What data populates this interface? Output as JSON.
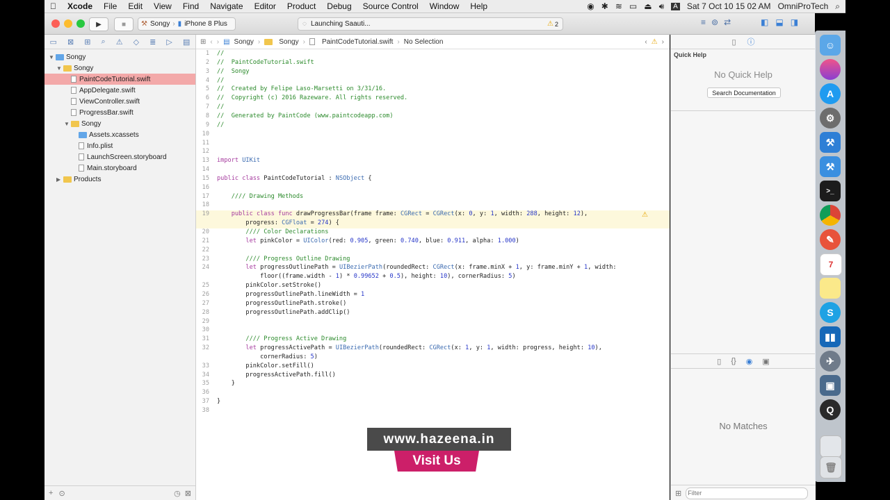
{
  "menubar": {
    "apple": "",
    "items": [
      "Xcode",
      "File",
      "Edit",
      "View",
      "Find",
      "Navigate",
      "Editor",
      "Product",
      "Debug",
      "Source Control",
      "Window",
      "Help"
    ],
    "clock": "Sat 7 Oct 10 15 02 AM",
    "user": "OmniProTech",
    "input_menu": "A"
  },
  "toolbar": {
    "scheme_project": "Songy",
    "scheme_device": "iPhone 8 Plus",
    "activity": "Launching Saauti...",
    "warning_count": "2"
  },
  "navigator": {
    "rows": [
      {
        "label": "Songy",
        "kind": "project",
        "indent": 0,
        "disclosure": "▼"
      },
      {
        "label": "Songy",
        "kind": "folder",
        "indent": 1,
        "disclosure": "▼"
      },
      {
        "label": "PaintCodeTutorial.swift",
        "kind": "file",
        "indent": 2,
        "selected": true
      },
      {
        "label": "AppDelegate.swift",
        "kind": "file",
        "indent": 2
      },
      {
        "label": "ViewController.swift",
        "kind": "file",
        "indent": 2
      },
      {
        "label": "ProgressBar.swift",
        "kind": "file",
        "indent": 2
      },
      {
        "label": "Songy",
        "kind": "folder",
        "indent": 2,
        "disclosure": "▼"
      },
      {
        "label": "Assets.xcassets",
        "kind": "asset",
        "indent": 3
      },
      {
        "label": "Info.plist",
        "kind": "file",
        "indent": 3
      },
      {
        "label": "LaunchScreen.storyboard",
        "kind": "file",
        "indent": 3
      },
      {
        "label": "Main.storyboard",
        "kind": "file",
        "indent": 3
      },
      {
        "label": "Products",
        "kind": "folder",
        "indent": 1,
        "disclosure": "▶"
      }
    ]
  },
  "jumpbar": {
    "crumbs": [
      "Songy",
      "Songy",
      "PaintCodeTutorial.swift",
      "No Selection"
    ]
  },
  "code": {
    "lines": [
      {
        "n": "1",
        "t": "//",
        "c": "cm"
      },
      {
        "n": "2",
        "t": "//  PaintCodeTutorial.swift",
        "c": "cm"
      },
      {
        "n": "3",
        "t": "//  Songy",
        "c": "cm"
      },
      {
        "n": "4",
        "t": "//",
        "c": "cm"
      },
      {
        "n": "5",
        "t": "//  Created by Felipe Laso-Marsetti on 3/31/16.",
        "c": "cm"
      },
      {
        "n": "6",
        "t": "//  Copyright (c) 2016 Razeware. All rights reserved.",
        "c": "cm"
      },
      {
        "n": "7",
        "t": "//",
        "c": "cm"
      },
      {
        "n": "8",
        "t": "//  Generated by PaintCode (www.paintcodeapp.com)",
        "c": "cm"
      },
      {
        "n": "9",
        "t": "//",
        "c": "cm"
      },
      {
        "n": "10",
        "t": "",
        "c": ""
      },
      {
        "n": "11",
        "t": "",
        "c": ""
      },
      {
        "n": "12",
        "t": "",
        "c": ""
      },
      {
        "n": "13",
        "t": "import UIKit",
        "c": ""
      },
      {
        "n": "14",
        "t": "",
        "c": ""
      },
      {
        "n": "15",
        "t": "public class PaintCodeTutorial : NSObject {",
        "c": ""
      },
      {
        "n": "16",
        "t": "",
        "c": ""
      },
      {
        "n": "17",
        "t": "    //// Drawing Methods",
        "c": "cm"
      },
      {
        "n": "18",
        "t": "",
        "c": ""
      },
      {
        "n": "19",
        "t": "    public class func drawProgressBar(frame frame: CGRect = CGRect(x: 0, y: 1, width: 288, height: 12),",
        "c": "",
        "hl": true
      },
      {
        "n": "",
        "t": "        progress: CGFloat = 274) {",
        "c": "",
        "hl": true
      },
      {
        "n": "20",
        "t": "        //// Color Declarations",
        "c": "cm"
      },
      {
        "n": "21",
        "t": "        let pinkColor = UIColor(red: 0.905, green: 0.740, blue: 0.911, alpha: 1.000)",
        "c": ""
      },
      {
        "n": "22",
        "t": "",
        "c": ""
      },
      {
        "n": "23",
        "t": "        //// Progress Outline Drawing",
        "c": "cm"
      },
      {
        "n": "24",
        "t": "        let progressOutlinePath = UIBezierPath(roundedRect: CGRect(x: frame.minX + 1, y: frame.minY + 1, width:",
        "c": ""
      },
      {
        "n": "",
        "t": "            floor((frame.width - 1) * 0.99652 + 0.5), height: 10), cornerRadius: 5)",
        "c": ""
      },
      {
        "n": "25",
        "t": "        pinkColor.setStroke()",
        "c": ""
      },
      {
        "n": "26",
        "t": "        progressOutlinePath.lineWidth = 1",
        "c": ""
      },
      {
        "n": "27",
        "t": "        progressOutlinePath.stroke()",
        "c": ""
      },
      {
        "n": "28",
        "t": "        progressOutlinePath.addClip()",
        "c": ""
      },
      {
        "n": "29",
        "t": "",
        "c": ""
      },
      {
        "n": "30",
        "t": "",
        "c": ""
      },
      {
        "n": "31",
        "t": "        //// Progress Active Drawing",
        "c": "cm"
      },
      {
        "n": "32",
        "t": "        let progressActivePath = UIBezierPath(roundedRect: CGRect(x: 1, y: 1, width: progress, height: 10),",
        "c": ""
      },
      {
        "n": "",
        "t": "            cornerRadius: 5)",
        "c": ""
      },
      {
        "n": "33",
        "t": "        pinkColor.setFill()",
        "c": ""
      },
      {
        "n": "34",
        "t": "        progressActivePath.fill()",
        "c": ""
      },
      {
        "n": "35",
        "t": "    }",
        "c": ""
      },
      {
        "n": "36",
        "t": "",
        "c": ""
      },
      {
        "n": "37",
        "t": "}",
        "c": ""
      },
      {
        "n": "38",
        "t": "",
        "c": ""
      }
    ]
  },
  "utilities": {
    "quick_help_title": "Quick Help",
    "no_quick_help": "No Quick Help",
    "search_docs": "Search Documentation",
    "no_matches": "No Matches",
    "filter_placeholder": "Filter"
  },
  "banner": {
    "url": "www.hazeena.in",
    "cta": "Visit Us"
  },
  "colors": {
    "selection": "#f3a9a9",
    "comment": "#2b8a2b",
    "keyword": "#a53a9e",
    "banner_pink": "#cc1f69"
  }
}
